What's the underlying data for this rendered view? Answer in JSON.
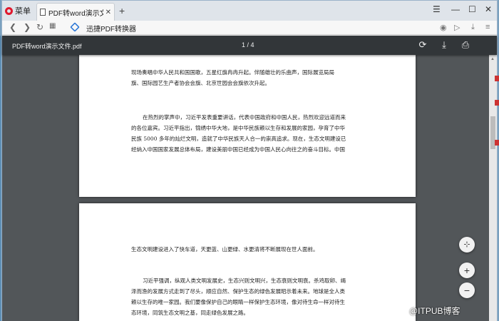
{
  "browser": {
    "menu_label": "菜单",
    "tab_title": "PDF转word演示文件.pdf",
    "new_tab_symbol": "+",
    "address_text": "迅捷PDF转换器"
  },
  "pdf": {
    "filename": "PDF转word演示文件.pdf",
    "page_indicator": "1 / 4",
    "page1_para1": [
      "现场奏唱中华人民共和国国歌，五星红旗冉冉升起。伴随雄壮的乐曲声，国际展览局局",
      "旗、国际园艺生产者协会会旗、北京世园会会旗依次升起。"
    ],
    "page1_para2": [
      "在热烈的掌声中，习近平发表重要讲话，代表中国政府和中国人民，热烈欢迎远道而来",
      "的各位嘉宾。习近平指出，锦绣中华大地，是中华民族赖以生存和发展的家园，孕育了中华",
      "民族 5000 多年的灿烂文明，造就了中华民族天人合一的崇高追求。现在，生态文明建设已",
      "经纳入中国国家发展总体布局，建设美丽中国已经成为中国人民心向往之的奋斗目标。中国"
    ],
    "page2_para1": [
      "生态文明建设进入了快车道，天更蓝、山更绿、水更清将不断展现在世人面前。"
    ],
    "page2_para2": [
      "习近平强调，纵观人类文明发展史，生态兴则文明兴，生态衰则文明衰。杀鸡取卵、竭",
      "泽而渔的发展方式走到了尽头，顺应自然、保护生态的绿色发展昭示着未来。地球是全人类",
      "赖以生存的唯一家园。我们要像保护自己的眼睛一样保护生态环境，像对待生命一样对待生",
      "态环境，同筑生态文明之基，同走绿色发展之路。"
    ]
  },
  "watermark": "@ITPUB博客"
}
